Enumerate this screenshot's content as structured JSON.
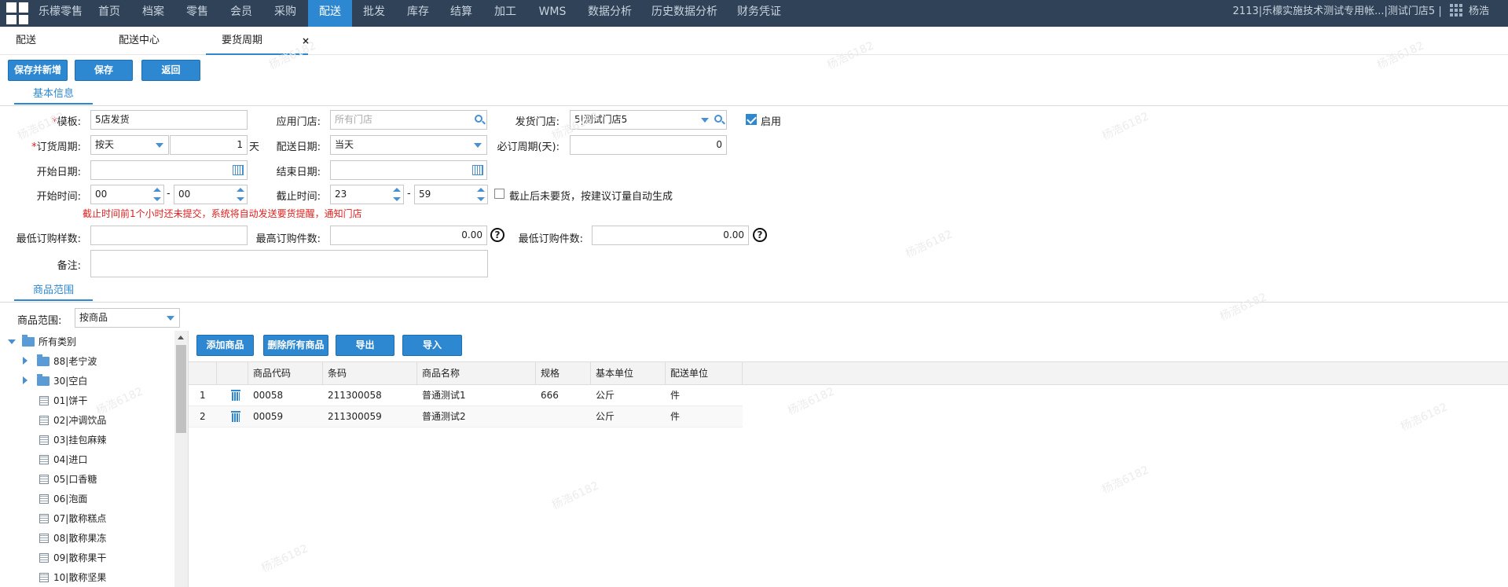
{
  "topnav": {
    "app_name": "乐檬零售",
    "items": [
      "首页",
      "档案",
      "零售",
      "会员",
      "采购",
      "配送",
      "批发",
      "库存",
      "结算",
      "加工",
      "WMS",
      "数据分析",
      "历史数据分析",
      "财务凭证"
    ],
    "active": "配送",
    "company": "2113|乐檬实施技术测试专用帐...|测试门店5",
    "separator": "|",
    "user": "杨浩"
  },
  "tabs": [
    {
      "label": "配送"
    },
    {
      "label": "配送中心"
    },
    {
      "label": "要货周期",
      "close": "×"
    }
  ],
  "toolbar": {
    "save_new": "保存并新增",
    "save": "保存",
    "back": "返回"
  },
  "sections": {
    "basic": "基本信息",
    "range": "商品范围"
  },
  "form": {
    "template_label": "模板:",
    "template_value": "5店发货",
    "store_label": "应用门店:",
    "store_placeholder": "所有门店",
    "ship_store_label": "发货门店:",
    "ship_store_value": "5|测试门店5",
    "enable_label": "启用",
    "enabled": true,
    "cycle_label": "订货周期:",
    "cycle_unit": "按天",
    "cycle_value": "1",
    "cycle_suffix": "天",
    "ship_date_label": "配送日期:",
    "ship_date_value": "当天",
    "required_cycle_label": "必订周期(天):",
    "required_cycle_value": "0",
    "start_date_label": "开始日期:",
    "end_date_label": "结束日期:",
    "start_time_label": "开始时间:",
    "start_hour": "00",
    "start_min": "00",
    "dash": "-",
    "cutoff_label": "截止时间:",
    "cutoff_hour": "23",
    "cutoff_min": "59",
    "auto_gen_label": "截止后未要货，按建议订量自动生成",
    "auto_gen": false,
    "warning": "截止时间前1个小时还未提交，系统将自动发送要货提醒，通知门店",
    "min_sku_label": "最低订购样数:",
    "max_qty_label": "最高订购件数:",
    "max_qty_value": "0.00",
    "min_qty_label": "最低订购件数:",
    "min_qty_value": "0.00",
    "help": "?",
    "remark_label": "备注:"
  },
  "range": {
    "label": "商品范围:",
    "value": "按商品"
  },
  "tree": {
    "root": "所有类别",
    "folders": [
      "88|老宁波",
      "30|空白"
    ],
    "leaves": [
      "01|饼干",
      "02|冲调饮品",
      "03|挂包麻辣",
      "04|进口",
      "05|口香糖",
      "06|泡面",
      "07|散称糕点",
      "08|散称果冻",
      "09|散称果干",
      "10|散称坚果"
    ]
  },
  "grid_toolbar": {
    "add": "添加商品",
    "delete_all": "删除所有商品",
    "export": "导出",
    "import": "导入"
  },
  "table": {
    "columns": [
      "商品代码",
      "条码",
      "商品名称",
      "规格",
      "基本单位",
      "配送单位"
    ],
    "rows": [
      {
        "no": "1",
        "code": "00058",
        "barcode": "211300058",
        "name": "普通测试1",
        "spec": "666",
        "unit": "公斤",
        "ship_unit": "件"
      },
      {
        "no": "2",
        "code": "00059",
        "barcode": "211300059",
        "name": "普通测试2",
        "spec": "",
        "unit": "公斤",
        "ship_unit": "件"
      }
    ]
  },
  "watermark": "杨浩6182",
  "colors": {
    "topbar": "#2f4257",
    "accent": "#2e88d1",
    "warning": "#e02020"
  }
}
